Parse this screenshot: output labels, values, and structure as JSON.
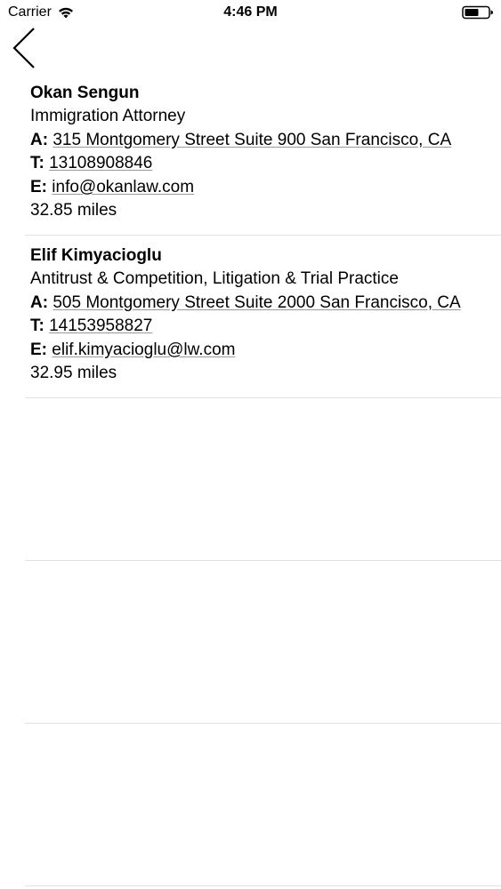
{
  "status_bar": {
    "carrier": "Carrier",
    "time": "4:46 PM"
  },
  "nav": {
    "back_icon": "chevron-left-icon"
  },
  "labels": {
    "address": "A:",
    "telephone": "T:",
    "email": "E:"
  },
  "results": [
    {
      "name": "Okan Sengun",
      "practice": "Immigration Attorney",
      "address": "315 Montgomery Street Suite 900 San Francisco, CA",
      "phone": "13108908846",
      "email": "info@okanlaw.com",
      "distance": "32.85 miles"
    },
    {
      "name": "Elif Kimyacioglu",
      "practice": "Antitrust & Competition, Litigation & Trial Practice",
      "address": "505 Montgomery Street Suite 2000 San Francisco, CA",
      "phone": "14153958827",
      "email": "elif.kimyacioglu@lw.com",
      "distance": "32.95 miles"
    }
  ],
  "colors": {
    "separator": "#e2e2e2",
    "text": "#000000"
  }
}
